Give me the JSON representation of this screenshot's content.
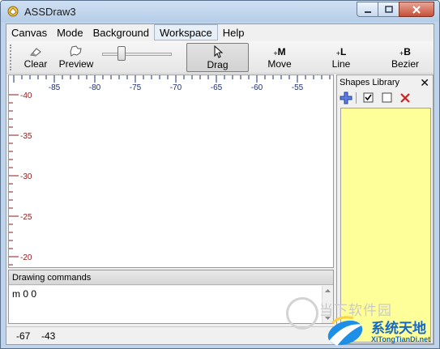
{
  "window": {
    "title": "ASSDraw3"
  },
  "menu": [
    "Canvas",
    "Mode",
    "Background",
    "Workspace",
    "Help"
  ],
  "toolbar": {
    "clear_label": "Clear",
    "preview_label": "Preview",
    "drag_label": "Drag",
    "move_label": "Move",
    "line_label": "Line",
    "bezier_label": "Bezier",
    "move_icon_text": "M",
    "line_icon_text": "L",
    "bezier_icon_text": "B",
    "slider_level": 0.25
  },
  "ruler": {
    "x_ticks": [
      "-85",
      "-80",
      "-75",
      "-70",
      "-65",
      "-60",
      "-55"
    ],
    "y_ticks": [
      "-40",
      "-35",
      "-30",
      "-25",
      "-20"
    ]
  },
  "drawing_commands": {
    "header": "Drawing commands",
    "text": "m 0 0"
  },
  "status": {
    "x": "-67",
    "y": "-43"
  },
  "shapes_library": {
    "title": "Shapes Library",
    "close": "✕"
  },
  "watermark": {
    "text": "当下软件园"
  },
  "brand": {
    "name": "系统天地",
    "url": "XiTongTianDi.net"
  },
  "colors": {
    "library_bg": "#ffff99",
    "ruler_tick_red": "#8b1a1a",
    "ruler_tick_blue": "#1c2f7a"
  }
}
